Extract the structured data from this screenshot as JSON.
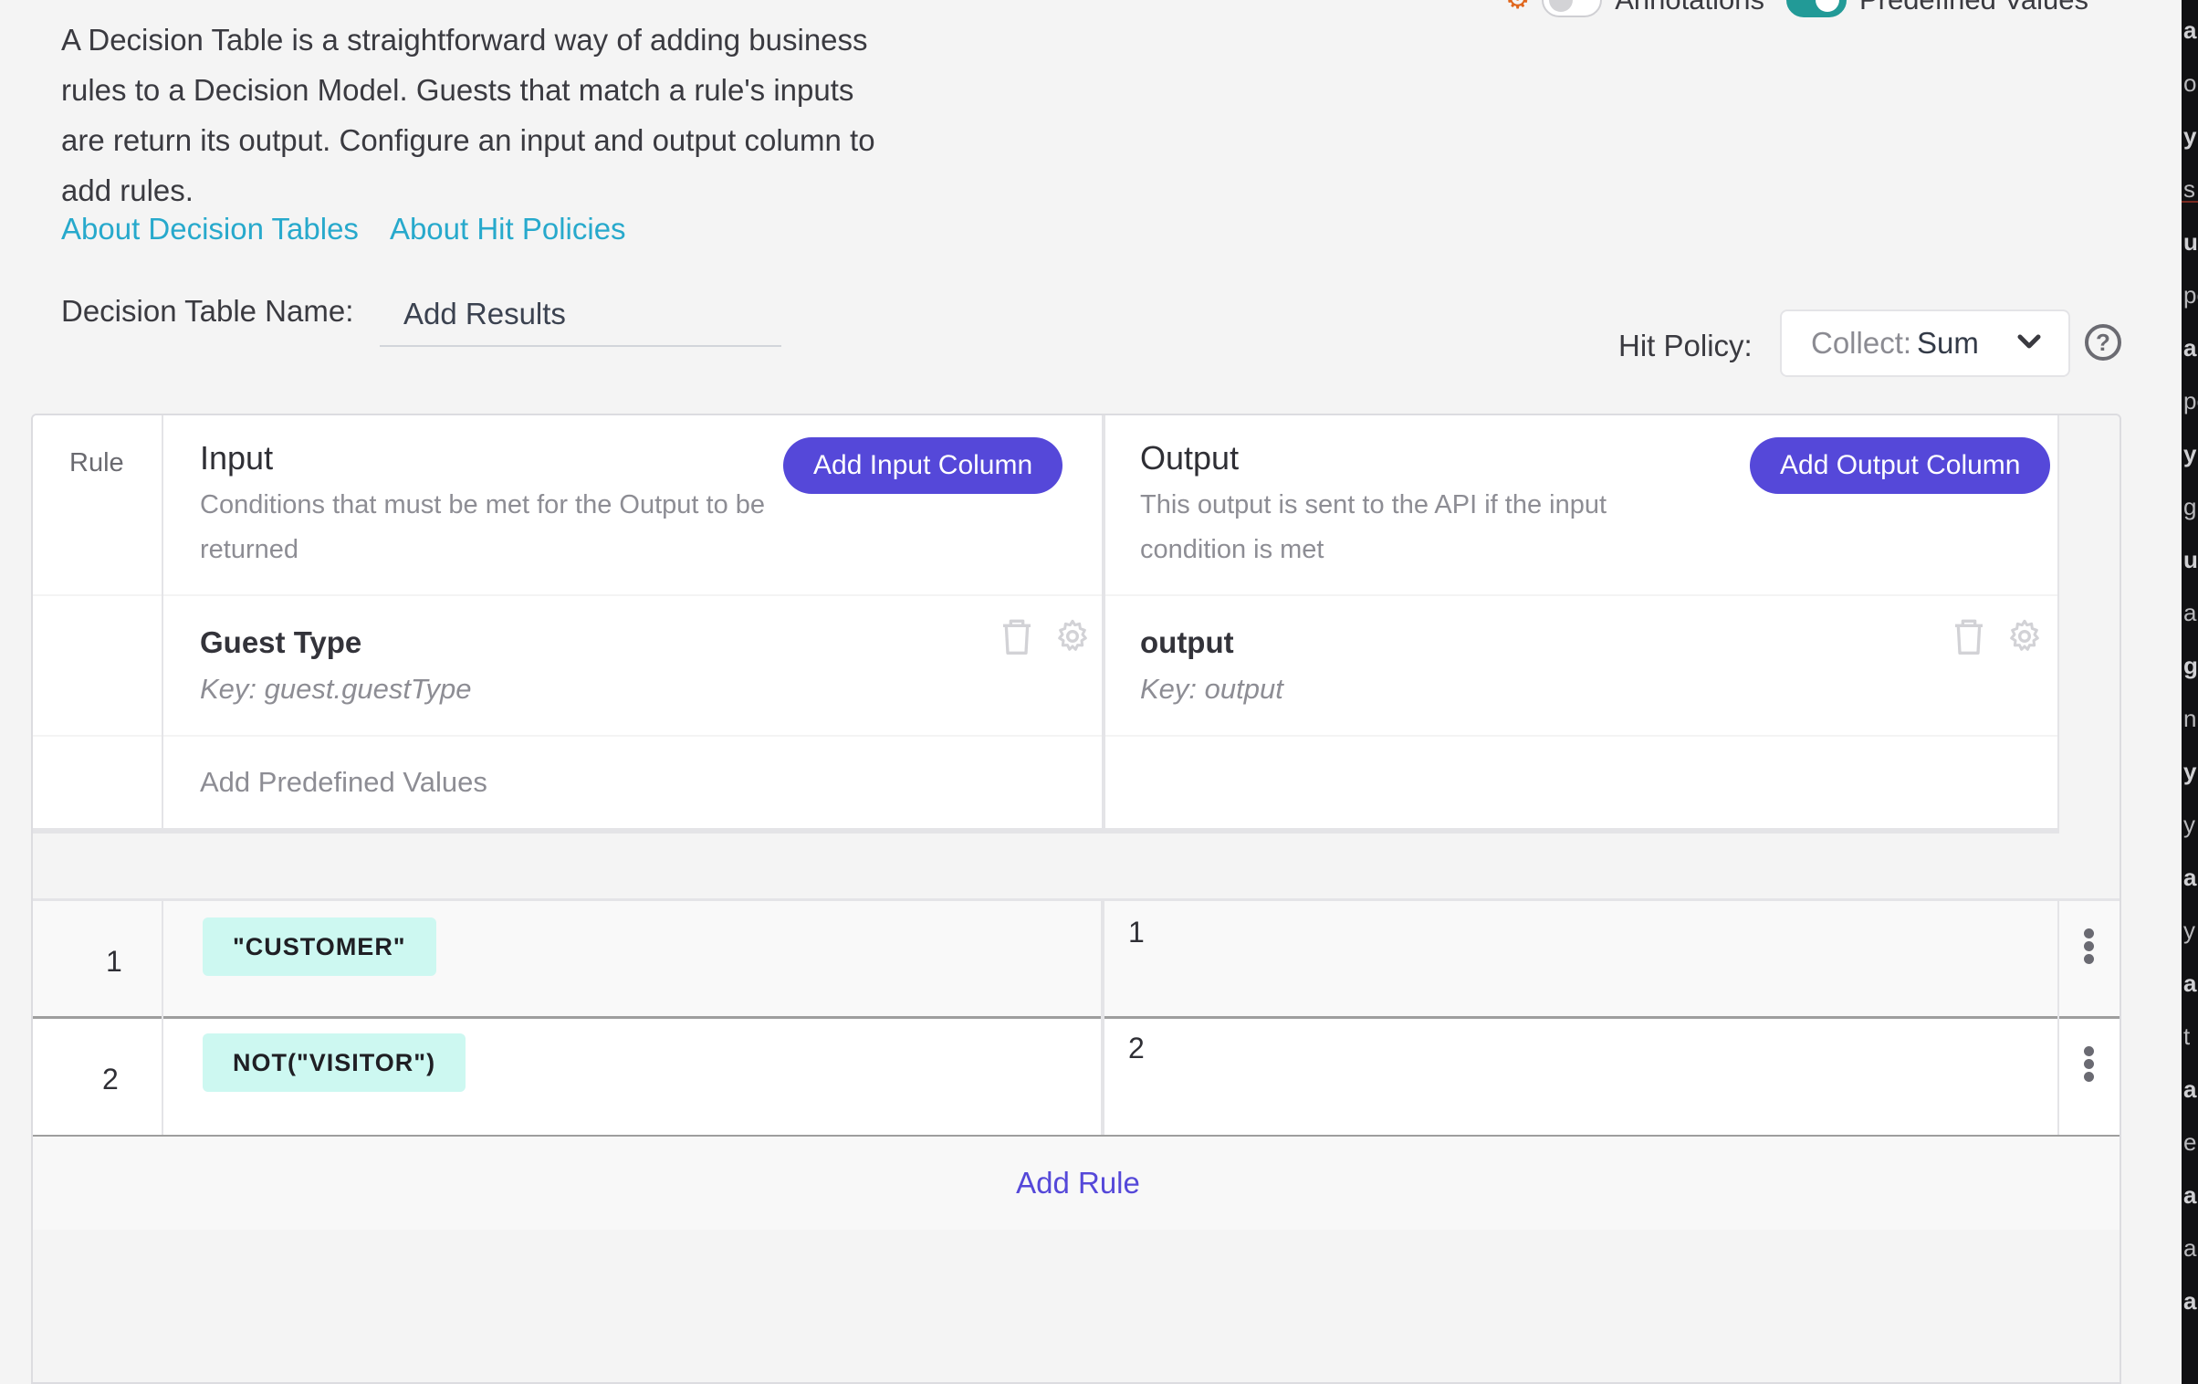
{
  "toolbar": {
    "annotations_label": "Annotations",
    "annotations_on": false,
    "predefined_values_label": "Predefined Values",
    "predefined_values_on": true,
    "accent_toggle_color": "#229a97",
    "settings_icon": "gear-icon"
  },
  "intro": {
    "description": "A Decision Table is a straightforward way of adding business rules to a Decision Model. Guests that match a rule's inputs are return its output. Configure an input and output column to add rules.",
    "links": [
      {
        "label": "About Decision Tables"
      },
      {
        "label": "About Hit Policies"
      }
    ]
  },
  "name_field": {
    "label": "Decision Table Name:",
    "value": "Add Results"
  },
  "hit_policy": {
    "label": "Hit Policy:",
    "prefix": "Collect:",
    "value": "Sum",
    "help_icon": "?"
  },
  "table": {
    "rule_header": "Rule",
    "input": {
      "title": "Input",
      "subtitle": "Conditions that must be met for the Output to be returned",
      "add_button": "Add Input Column",
      "column": {
        "name": "Guest Type",
        "key": "Key: guest.guestType"
      },
      "predefined_placeholder": "Add Predefined Values"
    },
    "output": {
      "title": "Output",
      "subtitle": "This output is sent to the API if the input condition is met",
      "add_button": "Add Output Column",
      "column": {
        "name": "output",
        "key": "Key: output"
      }
    },
    "rules": [
      {
        "number": "1",
        "input": "\"CUSTOMER\"",
        "output": "1"
      },
      {
        "number": "2",
        "input": "NOT(\"VISITOR\")",
        "output": "2"
      }
    ],
    "add_rule_label": "Add Rule",
    "primary_color": "#5548d9",
    "chip_color": "#cdf8f1"
  },
  "side_panel_fragments": [
    "a",
    "o",
    "y",
    "s",
    "u",
    "pe",
    "a",
    "pe",
    "y",
    "g",
    "u",
    "a",
    "g",
    "n",
    "y",
    "y",
    "a",
    "y",
    "a",
    "t",
    "a",
    "e",
    "a",
    "a",
    "a"
  ]
}
